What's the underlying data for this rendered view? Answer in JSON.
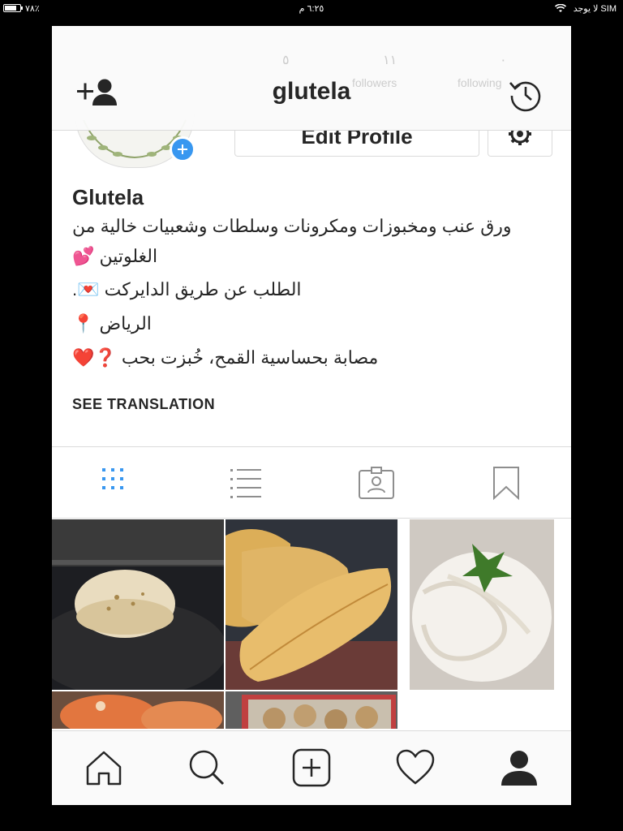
{
  "status": {
    "carrier": "لا يوجد SIM",
    "time": "٦:٢٥ م",
    "battery": "٧٨٪",
    "battery_level": 0.78
  },
  "header": {
    "username": "glutela",
    "stats": {
      "posts": "٥",
      "followers": "١١",
      "following": "٠"
    },
    "stat_labels": {
      "followers": "followers",
      "following": "following"
    }
  },
  "profile": {
    "edit_profile_label": "Edit Profile",
    "display_name": "Glutela",
    "bio": [
      "ورق عنب ومخبوزات ومكرونات وسلطات وشعبيات خالية من",
      "الغلوتين 💕",
      "الطلب عن طريق الدايركت 💌.",
      "الرياض 📍",
      "مصابة بحساسية القمح، خُبزت بحب ❓❤️"
    ],
    "see_translation": "SEE TRANSLATION"
  },
  "tabs": [
    {
      "name": "grid",
      "icon": "grid-icon",
      "active": true
    },
    {
      "name": "list",
      "icon": "list-icon",
      "active": false
    },
    {
      "name": "tagged",
      "icon": "tagged-photos-icon",
      "active": false
    },
    {
      "name": "saved",
      "icon": "bookmark-icon",
      "active": false
    }
  ],
  "posts": [
    {
      "subject": "flatbread on pan"
    },
    {
      "subject": "baguettes on tray"
    },
    {
      "subject": "fettuccine alfredo with parsley"
    },
    {
      "subject": "stuffed crab"
    },
    {
      "subject": "cookies in tin"
    }
  ],
  "nav": [
    {
      "name": "home",
      "icon": "home-icon"
    },
    {
      "name": "search",
      "icon": "search-icon"
    },
    {
      "name": "new-post",
      "icon": "plus-square-icon"
    },
    {
      "name": "activity",
      "icon": "heart-icon"
    },
    {
      "name": "profile",
      "icon": "profile-icon"
    }
  ],
  "colors": {
    "accent": "#3897f0",
    "text": "#262626",
    "border": "#dbdbdb",
    "bar_bg": "#fafafa"
  }
}
